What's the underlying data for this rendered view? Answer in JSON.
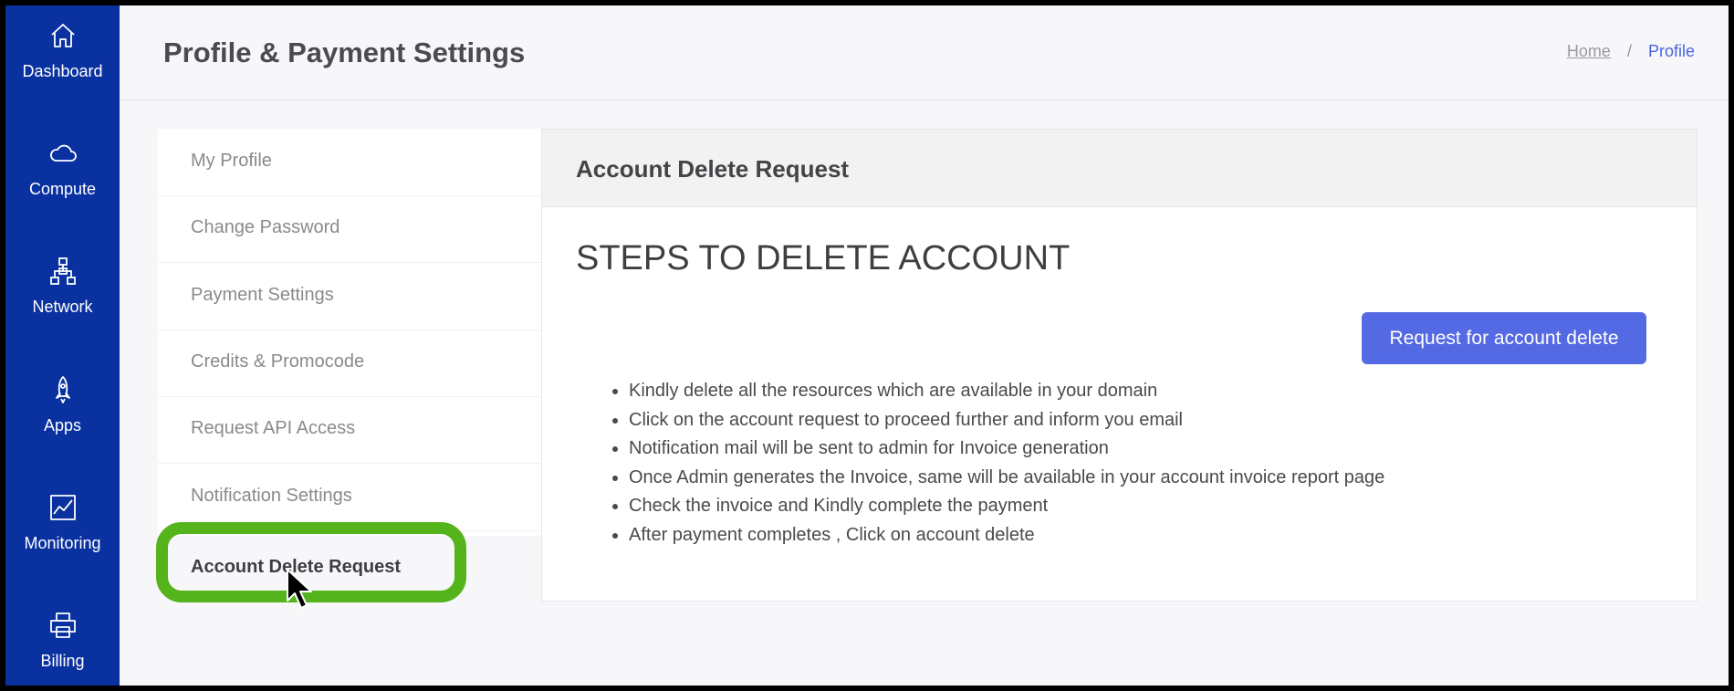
{
  "sidebar": {
    "items": [
      {
        "label": "Dashboard",
        "icon": "home-icon"
      },
      {
        "label": "Compute",
        "icon": "cloud-icon"
      },
      {
        "label": "Network",
        "icon": "network-icon"
      },
      {
        "label": "Apps",
        "icon": "rocket-icon"
      },
      {
        "label": "Monitoring",
        "icon": "chart-icon"
      },
      {
        "label": "Billing",
        "icon": "printer-icon"
      }
    ]
  },
  "header": {
    "title": "Profile & Payment Settings",
    "breadcrumb": {
      "home": "Home",
      "separator": "/",
      "current": "Profile"
    }
  },
  "settings_menu": {
    "items": [
      "My Profile",
      "Change Password",
      "Payment Settings",
      "Credits & Promocode",
      "Request API Access",
      "Notification Settings",
      "Account Delete Request"
    ],
    "active": "Account Delete Request"
  },
  "card": {
    "title": "Account Delete Request",
    "steps_title": "STEPS TO DELETE ACCOUNT",
    "button_label": "Request for account delete",
    "steps": [
      "Kindly delete all the resources which are available in your domain",
      "Click on the account request to proceed further and inform you email",
      "Notification mail will be sent to admin for Invoice generation",
      "Once Admin generates the Invoice, same will be available in your account invoice report page",
      "Check the invoice and Kindly complete the payment",
      "After payment completes , Click on account delete"
    ]
  },
  "colors": {
    "sidebar_bg": "#0a31a0",
    "accent": "#5469e4",
    "highlight": "#55b31c"
  }
}
